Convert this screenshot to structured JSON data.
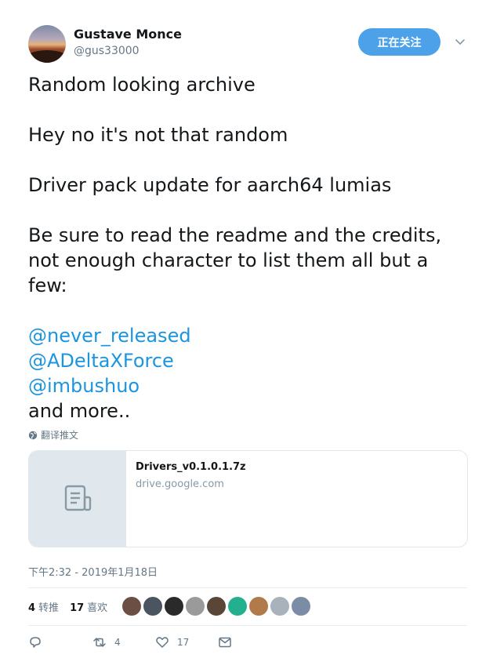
{
  "user": {
    "display_name": "Gustave Monce",
    "handle": "@gus33000",
    "follow_button": "正在关注"
  },
  "tweet": {
    "lines": [
      "Random looking archive",
      "Hey no it's not that random",
      "Driver pack update for aarch64 lumias",
      "Be sure to read the readme and the credits, not enough character to list them all but a few:"
    ],
    "mentions": [
      "@never_released",
      "@ADeltaXForce",
      "@imbushuo"
    ],
    "closing": "and more..",
    "translate_label": "翻译推文"
  },
  "card": {
    "title": "Drivers_v0.1.0.1.7z",
    "domain": "drive.google.com",
    "icon": "document-icon"
  },
  "timestamp": "下午2:32 - 2019年1月18日",
  "stats": {
    "retweets_count": "4",
    "retweets_label": "转推",
    "likes_count": "17",
    "likes_label": "喜欢"
  },
  "likers": [
    {
      "name": "liker-1",
      "color": "#6b4f45"
    },
    {
      "name": "liker-2",
      "color": "#4a5560"
    },
    {
      "name": "liker-3",
      "color": "#2a2a2a"
    },
    {
      "name": "liker-4",
      "color": "#9a9a9a"
    },
    {
      "name": "liker-5",
      "color": "#5a4636"
    },
    {
      "name": "liker-6",
      "color": "#22b08f"
    },
    {
      "name": "liker-7",
      "color": "#b07a4a"
    },
    {
      "name": "liker-8",
      "color": "#a9b1ba"
    },
    {
      "name": "liker-9",
      "color": "#7a8ca6"
    }
  ],
  "actions": {
    "reply_count": "",
    "retweet_count": "4",
    "like_count": "17"
  },
  "colors": {
    "accent": "#1b95e0",
    "follow_bg": "#4ca1e8",
    "muted": "#657786"
  }
}
